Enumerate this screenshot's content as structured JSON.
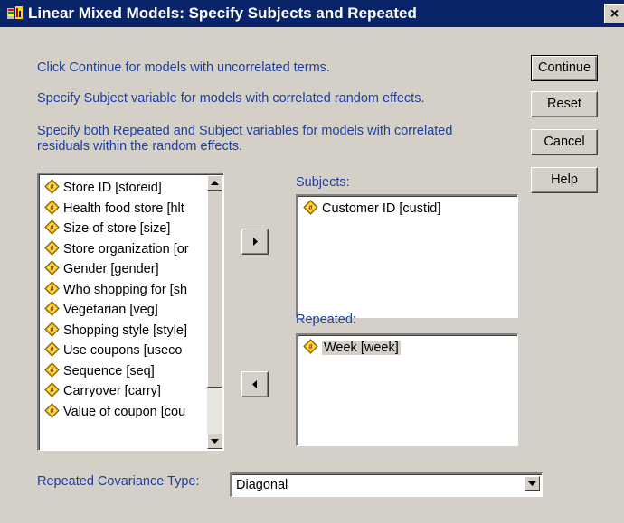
{
  "window": {
    "title": "Linear Mixed Models: Specify Subjects and Repeated",
    "close_glyph": "×"
  },
  "instructions": {
    "line1": "Click Continue for models with uncorrelated terms.",
    "line2": "Specify Subject variable for models with correlated random effects.",
    "line3a": "Specify both Repeated and Subject variables for models with correlated",
    "line3b": "residuals within the random effects."
  },
  "buttons": {
    "continue": "Continue",
    "reset": "Reset",
    "cancel": "Cancel",
    "help": "Help"
  },
  "variables": {
    "items": [
      "Store ID [storeid]",
      "Health food store [hlt",
      "Size of store [size]",
      "Store organization [or",
      "Gender [gender]",
      "Who shopping for [sh",
      "Vegetarian [veg]",
      "Shopping style [style]",
      "Use coupons [useco",
      "Sequence [seq]",
      "Carryover [carry]",
      "Value of coupon [cou"
    ]
  },
  "subjects": {
    "label": "Subjects:",
    "items": [
      "Customer ID [custid]"
    ]
  },
  "repeated": {
    "label": "Repeated:",
    "items": [
      "Week [week]"
    ]
  },
  "covariance": {
    "label": "Repeated Covariance Type:",
    "selected": "Diagonal"
  },
  "icons": {
    "variable": "scale-variable-icon",
    "move_right": "arrow-right-icon",
    "move_left": "arrow-left-icon",
    "app": "spss-app-icon"
  }
}
